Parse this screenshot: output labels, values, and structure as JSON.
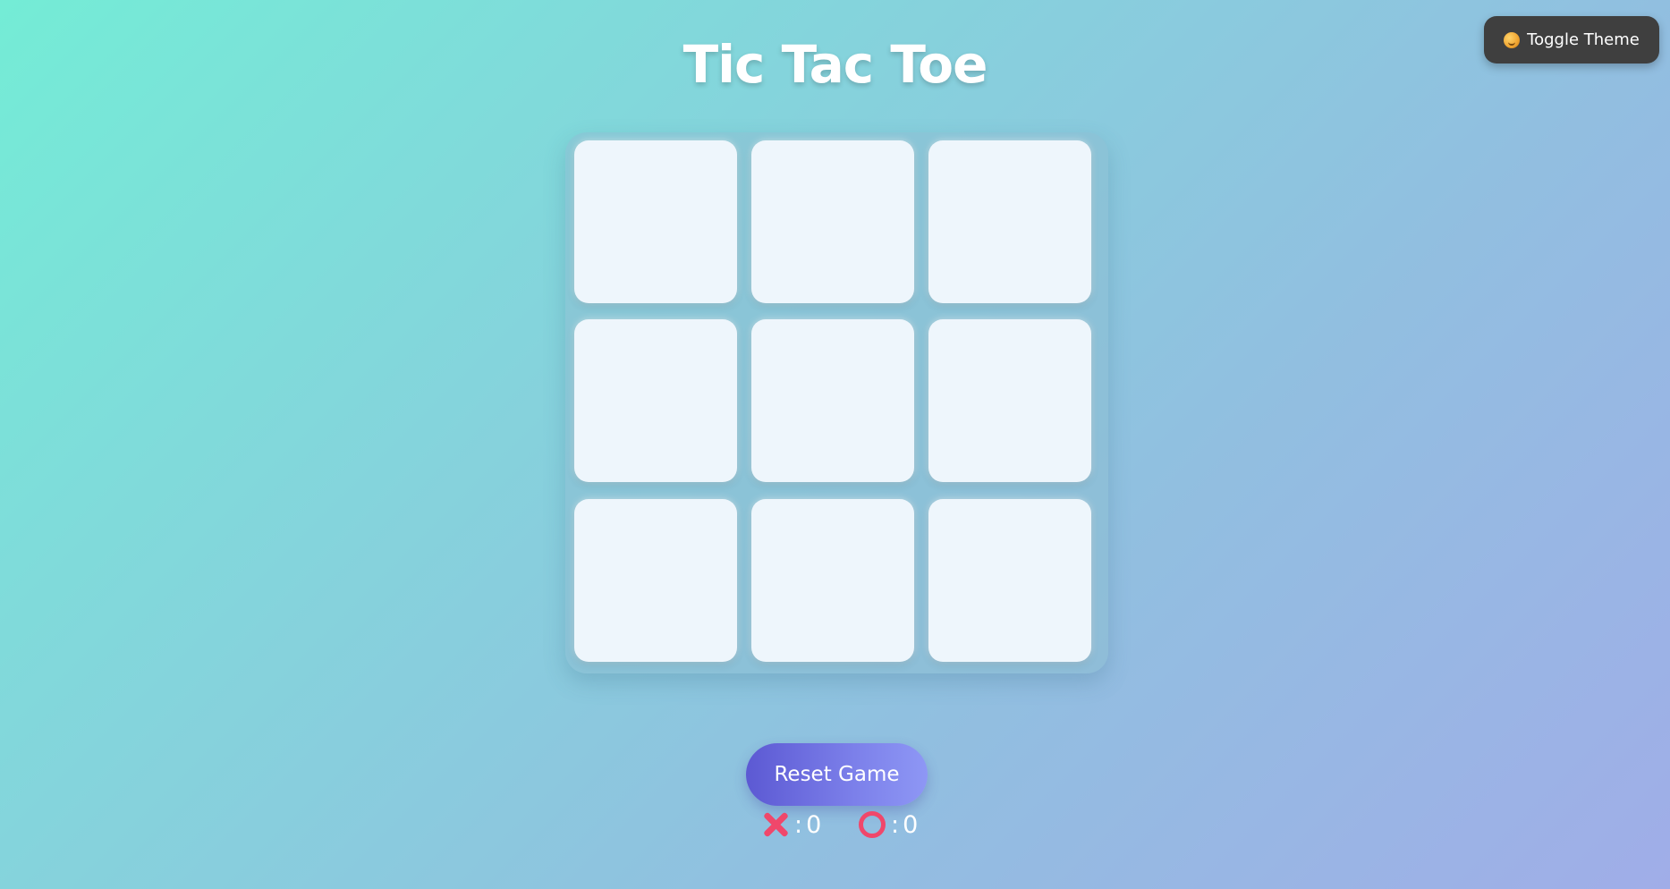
{
  "header": {
    "theme_toggle_label": "Toggle Theme",
    "theme_toggle_icon": "smiley-emoji-icon"
  },
  "title": "Tic Tac Toe",
  "board": {
    "cells": [
      "",
      "",
      "",
      "",
      "",
      "",
      "",
      "",
      ""
    ]
  },
  "controls": {
    "reset_label": "Reset Game"
  },
  "scores": {
    "separator": ":",
    "x": {
      "icon": "x-mark-icon",
      "value": "0"
    },
    "o": {
      "icon": "o-circle-icon",
      "value": "0"
    }
  },
  "colors": {
    "accent_gradient_start": "#5c59d3",
    "accent_gradient_end": "#8e97f5",
    "mark_color": "#f0476b",
    "toggle_bg": "#3f3f3f"
  }
}
